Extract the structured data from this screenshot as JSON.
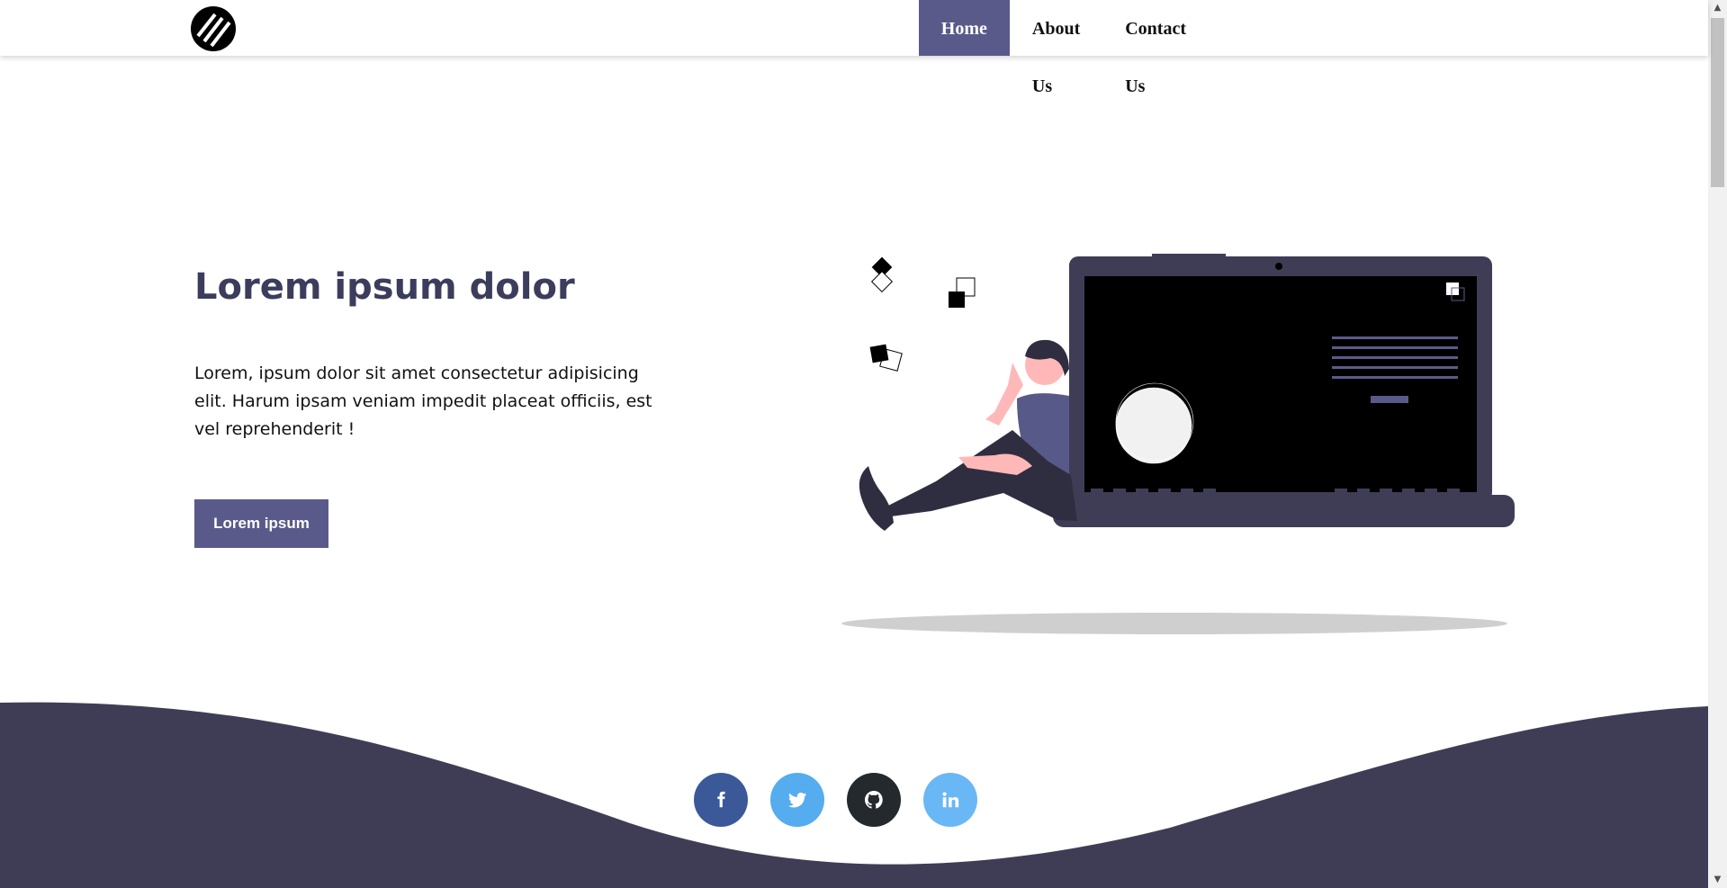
{
  "nav": {
    "items": [
      {
        "label": "Home",
        "active": true
      },
      {
        "label": "About Us",
        "active": false
      },
      {
        "label": "Contact Us",
        "active": false
      }
    ],
    "active_color": "#5a5a8a"
  },
  "hero": {
    "title": "Lorem ipsum dolor",
    "description": "Lorem, ipsum dolor sit amet consectetur adipisicing elit. Harum ipsam veniam impedit placeat officiis, est vel reprehenderit !",
    "button_label": "Lorem ipsum"
  },
  "socials": [
    {
      "icon": "facebook-icon",
      "color": "#3b5998"
    },
    {
      "icon": "twitter-icon",
      "color": "#55acee"
    },
    {
      "icon": "github-icon",
      "color": "#24292e"
    },
    {
      "icon": "linkedin-icon",
      "color": "#6ab7f5"
    }
  ],
  "colors": {
    "accent": "#5a5a8a",
    "footer": "#3f3d56",
    "title": "#3c3c5c"
  }
}
